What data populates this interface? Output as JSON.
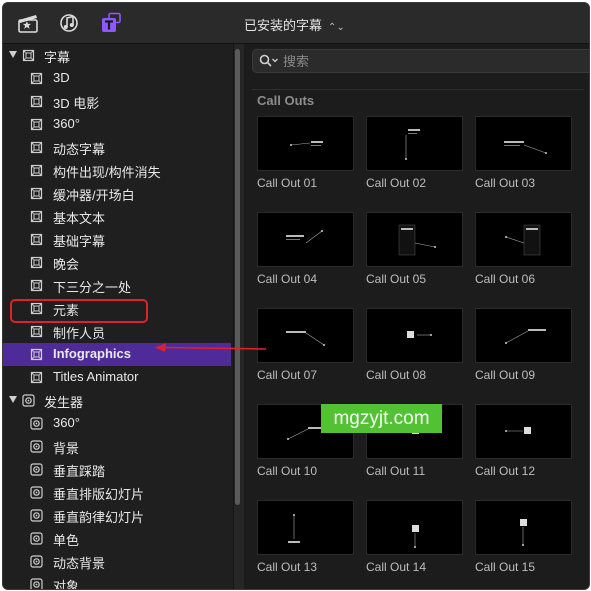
{
  "toolbar": {
    "icons": [
      "clapper-icon",
      "music-camera-icon",
      "titles-icon"
    ],
    "browser_title": "已安装的字幕",
    "accent": "#8f57ff"
  },
  "sidebar": {
    "titles_group": "字幕",
    "titles_items": [
      "3D",
      "3D 电影",
      "360°",
      "动态字幕",
      "构件出现/构件消失",
      "缓冲器/开场白",
      "基本文本",
      "基础字幕",
      "晚会",
      "下三分之一处",
      "元素",
      "制作人员",
      "Infographics",
      "Titles Animator"
    ],
    "selected_item": "Infographics",
    "generators_group": "发生器",
    "generators_items": [
      "360°",
      "背景",
      "垂直踩踏",
      "垂直排版幻灯片",
      "垂直韵律幻灯片",
      "单色",
      "动态背景",
      "对象"
    ],
    "selected_color": "#4f2b99",
    "highlight_color": "#e0202a"
  },
  "content": {
    "search_placeholder": "搜索",
    "section_title": "Call Outs",
    "items": [
      "Call Out 01",
      "Call Out 02",
      "Call Out 03",
      "Call Out 04",
      "Call Out 05",
      "Call Out 06",
      "Call Out 07",
      "Call Out 08",
      "Call Out 09",
      "Call Out 10",
      "Call Out 11",
      "Call Out 12",
      "Call Out 13",
      "Call Out 14",
      "Call Out 15"
    ]
  },
  "watermark": "mgzyjt.com"
}
